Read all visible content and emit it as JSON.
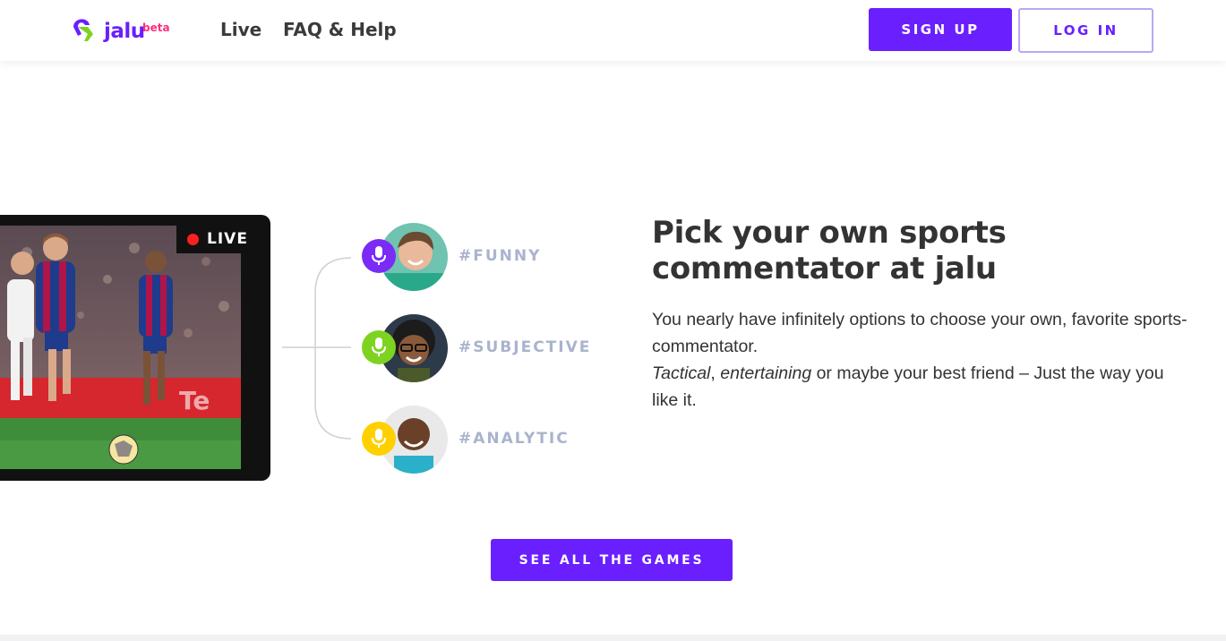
{
  "header": {
    "logo_text": "jalu",
    "logo_badge": "beta",
    "nav": [
      {
        "label": "Live"
      },
      {
        "label": "FAQ & Help"
      }
    ],
    "signup_label": "SIGN UP",
    "login_label": "LOG IN"
  },
  "video": {
    "live_label": "LIVE"
  },
  "commentators": [
    {
      "tag": "#FUNNY",
      "mic_color": "#7b2bf5",
      "icon": "microphone-icon"
    },
    {
      "tag": "#SUBJECTIVE",
      "mic_color": "#7ed321",
      "icon": "microphone-icon"
    },
    {
      "tag": "#ANALYTIC",
      "mic_color": "#ffd000",
      "icon": "microphone-icon"
    }
  ],
  "main": {
    "heading": "Pick your own sports commentator at jalu",
    "desc_line1": "You nearly have infinitely options to choose your own, favorite sports-commentator.",
    "desc_em1": "Tactical",
    "desc_sep": ", ",
    "desc_em2": "entertaining",
    "desc_rest": " or maybe your best friend – Just the way you like it.",
    "cta_label": "SEE ALL THE GAMES"
  },
  "colors": {
    "accent": "#6a1fff",
    "badge": "#ff2e7e",
    "tag": "#a9b4cc"
  }
}
